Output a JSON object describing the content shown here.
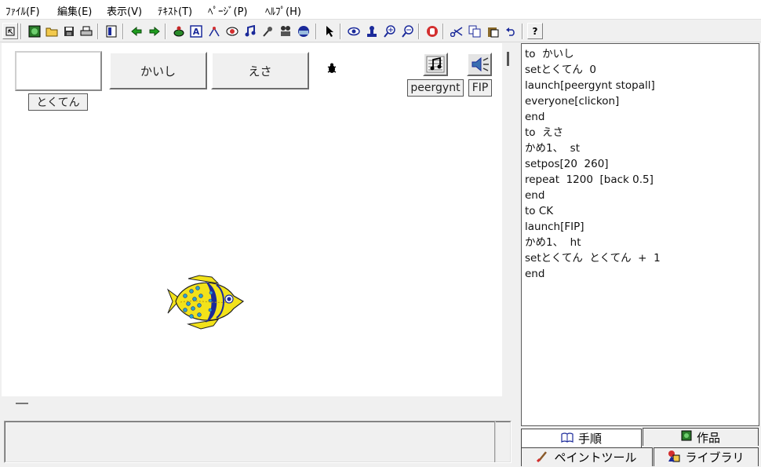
{
  "menubar": {
    "items": [
      {
        "label": "ﾌｧｲﾙ(F)"
      },
      {
        "label": "編集(E)"
      },
      {
        "label": "表示(V)"
      },
      {
        "label": "ﾃｷｽﾄ(T)"
      },
      {
        "label": "ﾍﾟｰｼﾞ(P)"
      },
      {
        "label": "ﾍﾙﾌﾟ(H)"
      }
    ]
  },
  "toolbar": {
    "help_label": "?"
  },
  "canvas": {
    "score_field_value": "",
    "kaishi_label": "かいし",
    "esa_label": "えさ",
    "score_label": "とくてん",
    "peergynt_label": "peergynt",
    "fip_label": "FIP"
  },
  "procedures": {
    "lines": [
      "to  かいし",
      "setとくてん  0",
      "launch[peergynt stopall]",
      "everyone[clickon]",
      "end",
      "to  えさ",
      "かめ1、  st",
      "setpos[20  260]",
      "repeat  1200  [back 0.5]",
      "end",
      "to CK",
      "launch[FIP]",
      "かめ1、  ht",
      "setとくてん  とくてん  +  1",
      "end"
    ]
  },
  "tabs": {
    "procedures": "手順",
    "works": "作品",
    "paint_tools": "ペイントツール",
    "library": "ライブラリ"
  },
  "colors": {
    "fish_body": "#f2e21a",
    "fish_stripe": "#1b2a9a",
    "fish_spots": "#2aa6c8"
  }
}
